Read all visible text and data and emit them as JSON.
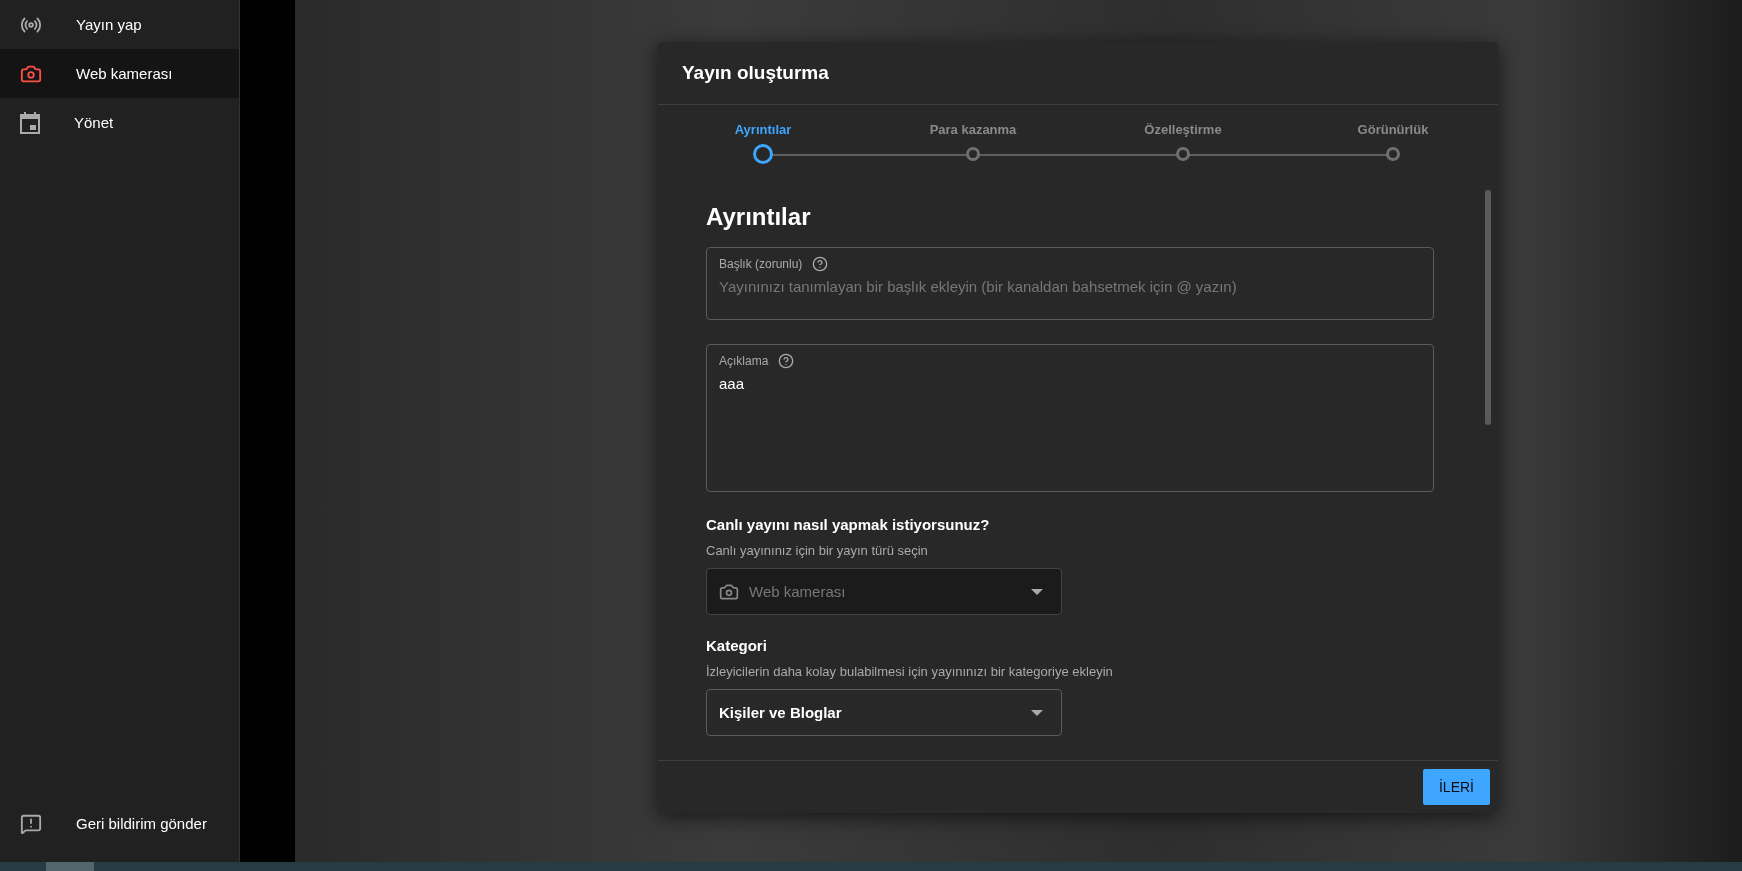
{
  "sidebar": {
    "items": [
      {
        "label": "Yayın yap",
        "selected": false
      },
      {
        "label": "Web kamerası",
        "selected": true
      },
      {
        "label": "Yönet",
        "selected": false
      }
    ],
    "footer_item": {
      "label": "Geri bildirim gönder"
    }
  },
  "dialog": {
    "title": "Yayın oluşturma",
    "steps": [
      {
        "label": "Ayrıntılar",
        "selected": true
      },
      {
        "label": "Para kazanma",
        "selected": false
      },
      {
        "label": "Özelleştirme",
        "selected": false
      },
      {
        "label": "Görünürlük",
        "selected": false
      }
    ],
    "section_title": "Ayrıntılar",
    "title_field": {
      "label": "Başlık (zorunlu)",
      "placeholder": "Yayınınızı tanımlayan bir başlık ekleyin (bir kanaldan bahsetmek için @ yazın)"
    },
    "description_field": {
      "label": "Açıklama",
      "value": "aaa"
    },
    "stream_type": {
      "heading": "Canlı yayını nasıl yapmak istiyorsunuz?",
      "hint": "Canlı yayınınız için bir yayın türü seçin",
      "value": "Web kamerası",
      "disabled": true
    },
    "category": {
      "heading": "Kategori",
      "hint": "İzleyicilerin daha kolay bulabilmesi için yayınınızı bir kategoriye ekleyin",
      "value": "Kişiler ve Bloglar",
      "disabled": false
    },
    "next_button": "İLERİ"
  }
}
